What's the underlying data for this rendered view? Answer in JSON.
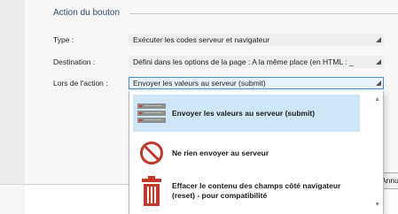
{
  "section": {
    "title": "Action du bouton"
  },
  "fields": [
    {
      "label": "Type :",
      "value": "Exécuter les codes serveur et navigateur"
    },
    {
      "label": "Destination :",
      "value": "Défini dans les options de la page : A la même place (en HTML : _"
    },
    {
      "label": "Lors de l'action :",
      "value": "Envoyer les valeurs au serveur (submit)"
    }
  ],
  "dropdown": {
    "options": [
      {
        "label": "Envoyer les valeurs au serveur (submit)",
        "icon": "server-icon",
        "selected": true
      },
      {
        "label": "Ne rien envoyer au serveur",
        "icon": "prohibited-icon",
        "selected": false
      },
      {
        "label": "Effacer le contenu des champs côté navigateur (reset) - pour compatibilité",
        "icon": "trash-icon",
        "selected": false
      }
    ]
  },
  "buttons": {
    "cancel": "Annuler"
  },
  "colors": {
    "accent": "#4a90c8",
    "selection": "#cfe6f7",
    "danger": "#c0392b",
    "title": "#2d4c6b"
  }
}
